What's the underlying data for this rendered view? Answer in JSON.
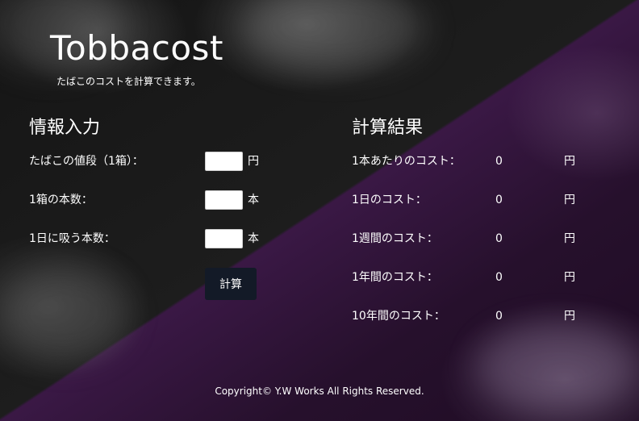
{
  "header": {
    "title": "Tobbacost",
    "subtitle": "たばこのコストを計算できます。"
  },
  "input_section": {
    "heading": "情報入力",
    "fields": [
      {
        "label": "たばこの値段（1箱）：",
        "value": "",
        "unit": "円"
      },
      {
        "label": "1箱の本数：",
        "value": "",
        "unit": "本"
      },
      {
        "label": "1日に吸う本数：",
        "value": "",
        "unit": "本"
      }
    ],
    "button_label": "計算"
  },
  "result_section": {
    "heading": "計算結果",
    "rows": [
      {
        "label": "1本あたりのコスト：",
        "value": "0",
        "unit": "円"
      },
      {
        "label": "1日のコスト：",
        "value": "0",
        "unit": "円"
      },
      {
        "label": "1週間のコスト：",
        "value": "0",
        "unit": "円"
      },
      {
        "label": "1年間のコスト：",
        "value": "0",
        "unit": "円"
      },
      {
        "label": "10年間のコスト：",
        "value": "0",
        "unit": "円"
      }
    ]
  },
  "footer": {
    "copyright": "Copyright© Y.W Works All Rights Reserved."
  },
  "colors": {
    "background_dark": "#1a1a1a",
    "background_purple": "#3a1845",
    "button_bg": "#131a27",
    "text": "#ffffff"
  }
}
